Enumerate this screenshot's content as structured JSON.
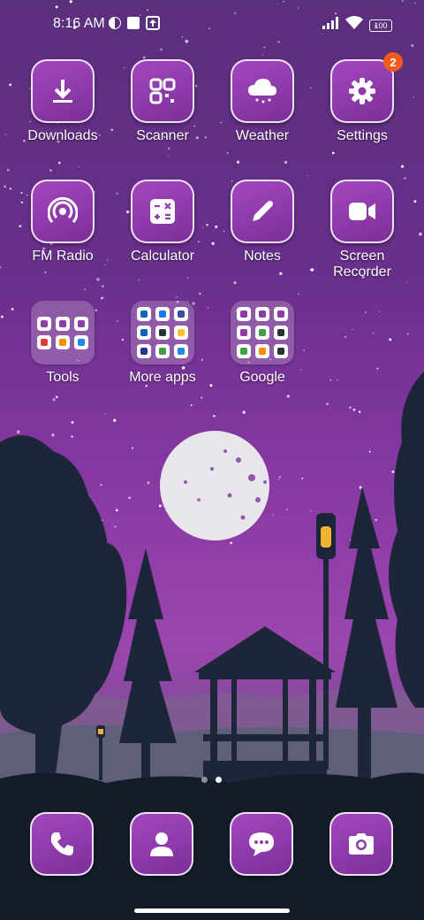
{
  "status": {
    "time": "8:16 AM",
    "battery": "100"
  },
  "apps": [
    {
      "name": "downloads",
      "label": "Downloads",
      "icon": "download-icon"
    },
    {
      "name": "scanner",
      "label": "Scanner",
      "icon": "scanner-icon"
    },
    {
      "name": "weather",
      "label": "Weather",
      "icon": "weather-cloud-icon"
    },
    {
      "name": "settings",
      "label": "Settings",
      "icon": "gear-icon",
      "badge": "2"
    },
    {
      "name": "fm-radio",
      "label": "FM Radio",
      "icon": "radio-icon"
    },
    {
      "name": "calculator",
      "label": "Calculator",
      "icon": "calculator-icon"
    },
    {
      "name": "notes",
      "label": "Notes",
      "icon": "pencil-icon"
    },
    {
      "name": "screen-recorder",
      "label": "Screen Recorder",
      "icon": "video-camera-icon"
    }
  ],
  "folders": [
    {
      "name": "tools",
      "label": "Tools"
    },
    {
      "name": "more-apps",
      "label": "More apps"
    },
    {
      "name": "google",
      "label": "Google"
    }
  ],
  "dock": [
    {
      "name": "phone",
      "icon": "phone-icon"
    },
    {
      "name": "contacts",
      "icon": "contact-icon"
    },
    {
      "name": "messages",
      "icon": "chat-bubble-icon"
    },
    {
      "name": "camera",
      "icon": "camera-icon"
    }
  ],
  "colors": {
    "accent": "#8e3aa8",
    "badge": "#f05a1a"
  },
  "pages": {
    "count": 2,
    "current": 2
  }
}
